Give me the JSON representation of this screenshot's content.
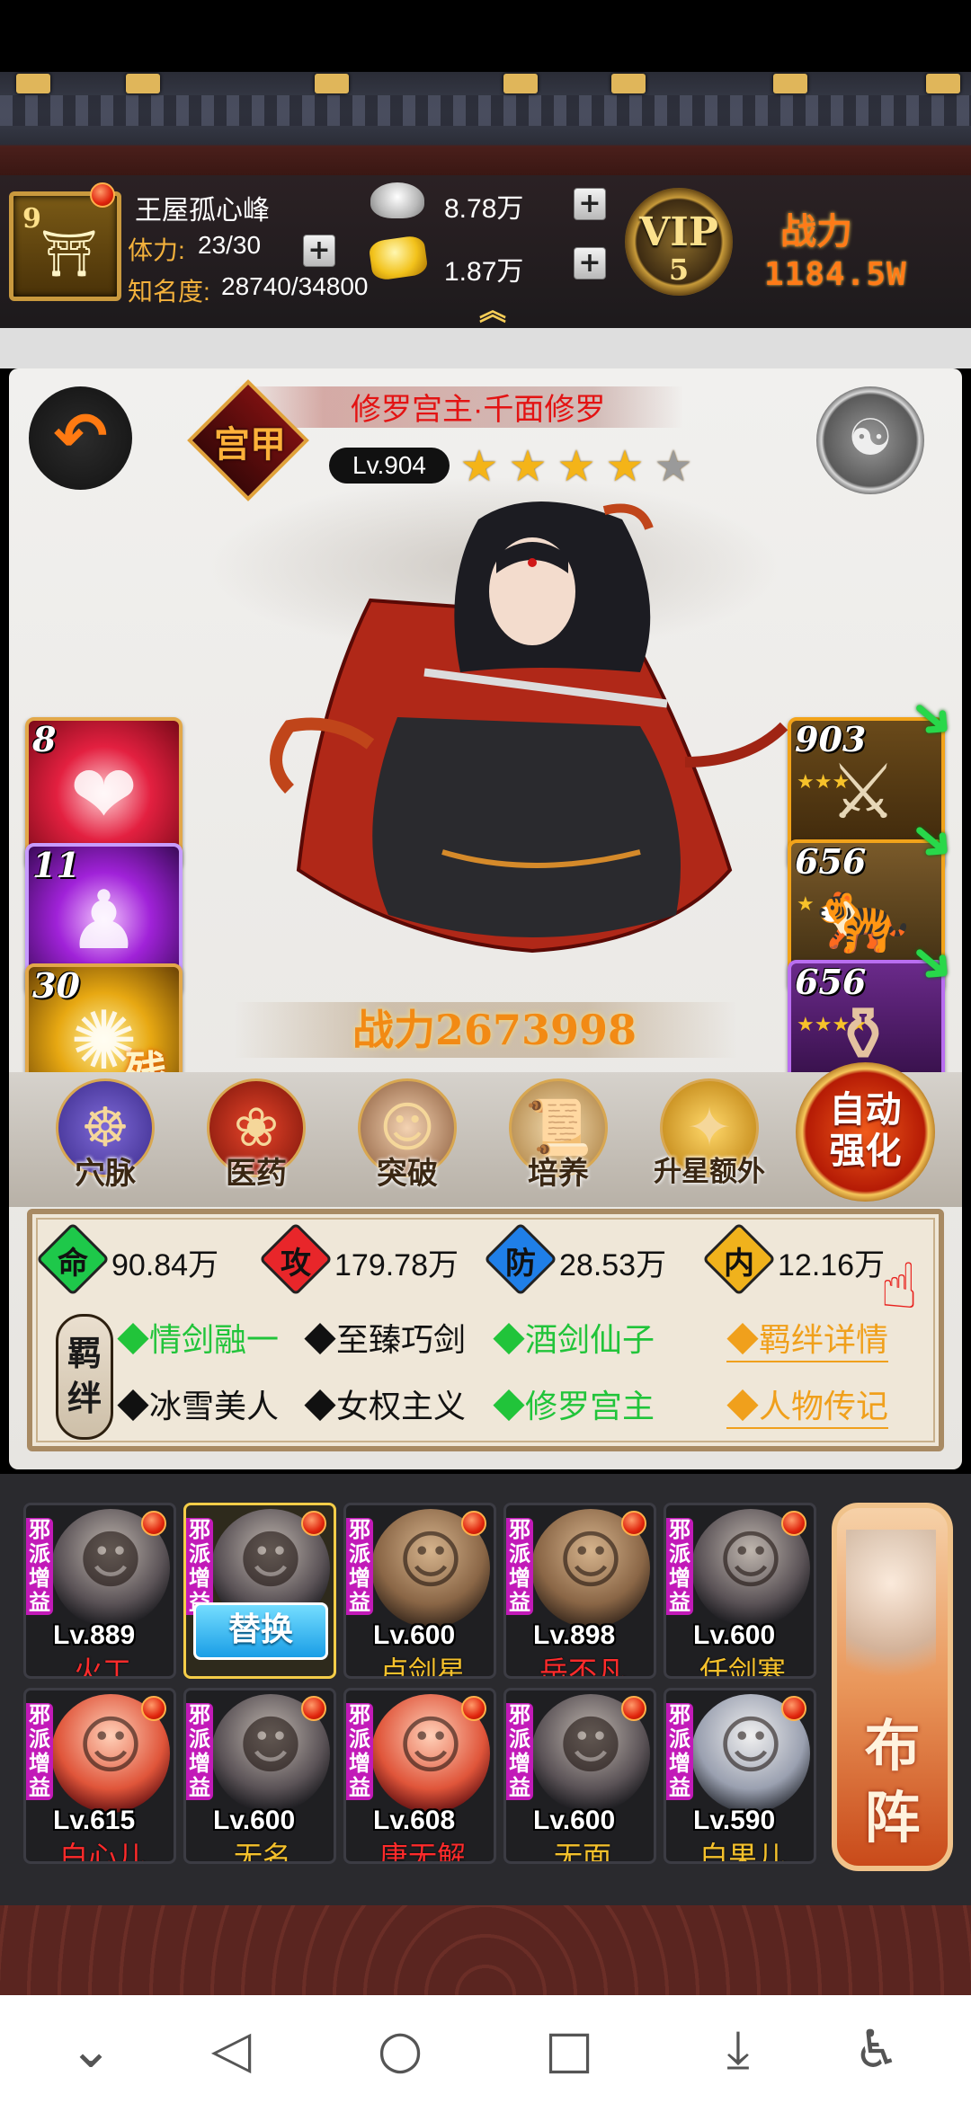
{
  "player": {
    "name": "王屋孤心峰",
    "level": "9",
    "stamina_label": "体力:",
    "stamina": "23/30",
    "fame_label": "知名度:",
    "fame": "28740/34800",
    "silver": "8.78万",
    "gold": "1.87万",
    "vip_label": "VIP",
    "vip_level": "5",
    "power_title": "战力",
    "power": "1184.5W"
  },
  "hero": {
    "name": "修罗宫主·千面修罗",
    "sect_badge": "宫甲",
    "level": "Lv.904",
    "stars_total": 5,
    "stars_filled": 4,
    "power": "战力2673998"
  },
  "skills": [
    {
      "level": "8",
      "icon": "heart-vortex-icon",
      "tag": ""
    },
    {
      "level": "11",
      "icon": "shadow-strike-icon",
      "tag": ""
    },
    {
      "level": "30",
      "icon": "golden-flame-icon",
      "tag": "残"
    }
  ],
  "equipment": [
    {
      "level": "903",
      "icon": "sword-icon",
      "stars": 3
    },
    {
      "level": "656",
      "icon": "tiger-icon",
      "stars": 1
    },
    {
      "level": "656",
      "icon": "vase-icon",
      "stars": 4
    }
  ],
  "functions": [
    {
      "label": "穴脉",
      "icon": "meridian-icon"
    },
    {
      "label": "医药",
      "icon": "lingzhi-icon"
    },
    {
      "label": "突破",
      "icon": "breakthrough-icon"
    },
    {
      "label": "培养",
      "icon": "scroll-icon"
    },
    {
      "label": "升星额外",
      "icon": "treasure-icon"
    }
  ],
  "auto_enhance": {
    "line1": "自动",
    "line2": "强化"
  },
  "stats": [
    {
      "glyph": "命",
      "value": "90.84万",
      "color": "#1ec84a"
    },
    {
      "glyph": "攻",
      "value": "179.78万",
      "color": "#e8262a"
    },
    {
      "glyph": "防",
      "value": "28.53万",
      "color": "#1f7fe8"
    },
    {
      "glyph": "内",
      "value": "12.16万",
      "color": "#f0b21c"
    }
  ],
  "bond_seal": "羁绊",
  "bonds": [
    {
      "text": "◆情剑融一",
      "active": true
    },
    {
      "text": "◆至臻巧剑",
      "active": false
    },
    {
      "text": "◆酒剑仙子",
      "active": true
    },
    {
      "text": "◆冰雪美人",
      "active": false
    },
    {
      "text": "◆女权主义",
      "active": false
    },
    {
      "text": "◆修罗宫主",
      "active": true
    }
  ],
  "bond_links": {
    "details": "◆羁绊详情",
    "biography": "◆人物传记"
  },
  "roster_badge": "邪派增益",
  "roster": [
    {
      "level": "Lv.889",
      "name": "火工",
      "name_color": "red",
      "portrait": "bald-warrior"
    },
    {
      "level": "",
      "name": "",
      "name_color": "gold",
      "portrait": "swordswoman",
      "selected": true
    },
    {
      "level": "Lv.600",
      "name": "卢剑星",
      "name_color": "gold",
      "portrait": "young-swordsman"
    },
    {
      "level": "Lv.898",
      "name": "岳不凡",
      "name_color": "red",
      "portrait": "scholar"
    },
    {
      "level": "Lv.600",
      "name": "任剑寒",
      "name_color": "gold",
      "portrait": "dark-hair-man"
    },
    {
      "level": "Lv.615",
      "name": "白心儿",
      "name_color": "red",
      "portrait": "maiden"
    },
    {
      "level": "Lv.600",
      "name": "无名",
      "name_color": "gold",
      "portrait": "masked-man"
    },
    {
      "level": "Lv.608",
      "name": "唐无解",
      "name_color": "red",
      "portrait": "young-man"
    },
    {
      "level": "Lv.600",
      "name": "无面",
      "name_color": "gold",
      "portrait": "veiled-figure"
    },
    {
      "level": "Lv.590",
      "name": "白果儿",
      "name_color": "gold",
      "portrait": "armored-girl"
    }
  ],
  "replace_label": "替换",
  "formation": {
    "line1": "布",
    "line2": "阵"
  }
}
